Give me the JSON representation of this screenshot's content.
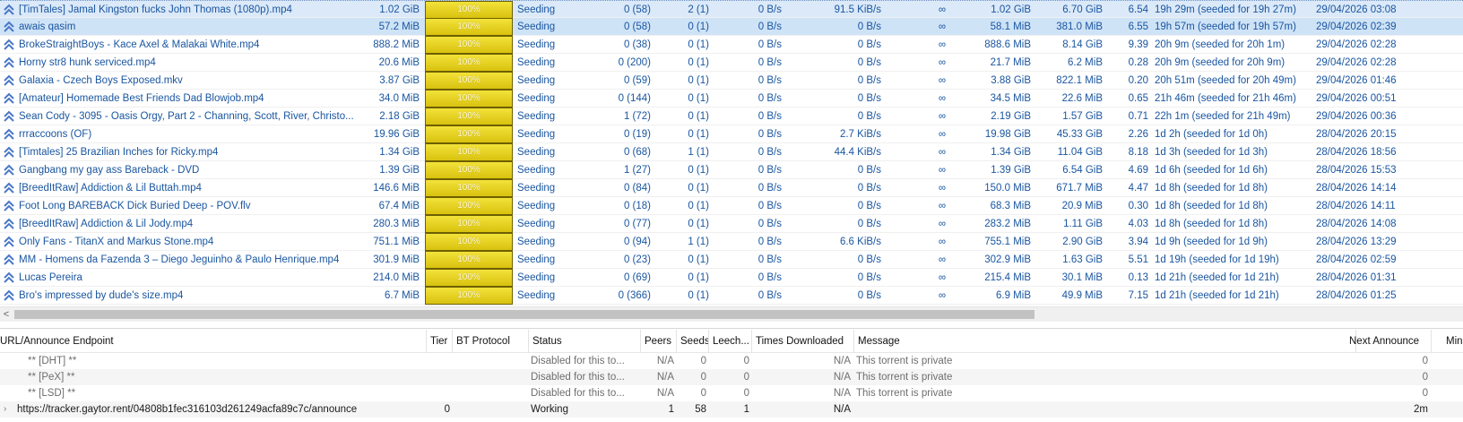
{
  "colors": {
    "selected_row": "#cfe3f7",
    "progress_fill": "#e6d21c",
    "text_blue": "#1a56a0",
    "priority_arrow": "#4a78c8"
  },
  "icons": {
    "row_state": "double-chevron-up-icon",
    "expand": "chevron-right-icon",
    "scroll_left": "arrow-left-icon"
  },
  "torrents": [
    {
      "name": "[TimTales] Jamal Kingston fucks John Thomas (1080p).mp4",
      "size": "1.02 GiB",
      "progress_label": "100%",
      "progress": 1.0,
      "status": "Seeding",
      "seeds": "0 (58)",
      "peers": "2 (1)",
      "down_speed": "0 B/s",
      "up_speed": "91.5 KiB/s",
      "eta": "∞",
      "downloaded": "1.02 GiB",
      "uploaded": "6.70 GiB",
      "ratio": "6.54",
      "seeding_time": "19h 29m (seeded for 19h 27m)",
      "added_on": "29/04/2026 03:08"
    },
    {
      "name": "awais qasim",
      "size": "57.2 MiB",
      "progress_label": "100%",
      "progress": 1.0,
      "status": "Seeding",
      "seeds": "0 (58)",
      "peers": "0 (1)",
      "down_speed": "0 B/s",
      "up_speed": "0 B/s",
      "eta": "∞",
      "downloaded": "58.1 MiB",
      "uploaded": "381.0 MiB",
      "ratio": "6.55",
      "seeding_time": "19h 57m (seeded for 19h 57m)",
      "added_on": "29/04/2026 02:39"
    },
    {
      "name": "BrokeStraightBoys - Kace Axel & Malakai White.mp4",
      "size": "888.2 MiB",
      "progress_label": "100%",
      "progress": 1.0,
      "status": "Seeding",
      "seeds": "0 (38)",
      "peers": "0 (1)",
      "down_speed": "0 B/s",
      "up_speed": "0 B/s",
      "eta": "∞",
      "downloaded": "888.6 MiB",
      "uploaded": "8.14 GiB",
      "ratio": "9.39",
      "seeding_time": "20h 9m (seeded for 20h 1m)",
      "added_on": "29/04/2026 02:28"
    },
    {
      "name": "Horny str8 hunk serviced.mp4",
      "size": "20.6 MiB",
      "progress_label": "100%",
      "progress": 1.0,
      "status": "Seeding",
      "seeds": "0 (200)",
      "peers": "0 (1)",
      "down_speed": "0 B/s",
      "up_speed": "0 B/s",
      "eta": "∞",
      "downloaded": "21.7 MiB",
      "uploaded": "6.2 MiB",
      "ratio": "0.28",
      "seeding_time": "20h 9m (seeded for 20h 9m)",
      "added_on": "29/04/2026 02:28"
    },
    {
      "name": "Galaxia - Czech Boys Exposed.mkv",
      "size": "3.87 GiB",
      "progress_label": "100%",
      "progress": 1.0,
      "status": "Seeding",
      "seeds": "0 (59)",
      "peers": "0 (1)",
      "down_speed": "0 B/s",
      "up_speed": "0 B/s",
      "eta": "∞",
      "downloaded": "3.88 GiB",
      "uploaded": "822.1 MiB",
      "ratio": "0.20",
      "seeding_time": "20h 51m (seeded for 20h 49m)",
      "added_on": "29/04/2026 01:46"
    },
    {
      "name": "[Amateur] Homemade Best Friends Dad Blowjob.mp4",
      "size": "34.0 MiB",
      "progress_label": "100%",
      "progress": 1.0,
      "status": "Seeding",
      "seeds": "0 (144)",
      "peers": "0 (1)",
      "down_speed": "0 B/s",
      "up_speed": "0 B/s",
      "eta": "∞",
      "downloaded": "34.5 MiB",
      "uploaded": "22.6 MiB",
      "ratio": "0.65",
      "seeding_time": "21h 46m (seeded for 21h 46m)",
      "added_on": "29/04/2026 00:51"
    },
    {
      "name": "Sean Cody - 3095 - Oasis Orgy, Part 2 - Channing, Scott, River, Christo...",
      "size": "2.18 GiB",
      "progress_label": "100%",
      "progress": 1.0,
      "status": "Seeding",
      "seeds": "1 (72)",
      "peers": "0 (1)",
      "down_speed": "0 B/s",
      "up_speed": "0 B/s",
      "eta": "∞",
      "downloaded": "2.19 GiB",
      "uploaded": "1.57 GiB",
      "ratio": "0.71",
      "seeding_time": "22h 1m (seeded for 21h 49m)",
      "added_on": "29/04/2026 00:36"
    },
    {
      "name": "rrraccoons (OF)",
      "size": "19.96 GiB",
      "progress_label": "100%",
      "progress": 1.0,
      "status": "Seeding",
      "seeds": "0 (19)",
      "peers": "0 (1)",
      "down_speed": "0 B/s",
      "up_speed": "2.7 KiB/s",
      "eta": "∞",
      "downloaded": "19.98 GiB",
      "uploaded": "45.33 GiB",
      "ratio": "2.26",
      "seeding_time": "1d 2h (seeded for 1d 0h)",
      "added_on": "28/04/2026 20:15"
    },
    {
      "name": "[Timtales] 25 Brazilian Inches for Ricky.mp4",
      "size": "1.34 GiB",
      "progress_label": "100%",
      "progress": 1.0,
      "status": "Seeding",
      "seeds": "0 (68)",
      "peers": "1 (1)",
      "down_speed": "0 B/s",
      "up_speed": "44.4 KiB/s",
      "eta": "∞",
      "downloaded": "1.34 GiB",
      "uploaded": "11.04 GiB",
      "ratio": "8.18",
      "seeding_time": "1d 3h (seeded for 1d 3h)",
      "added_on": "28/04/2026 18:56"
    },
    {
      "name": "Gangbang my gay ass Bareback - DVD",
      "size": "1.39 GiB",
      "progress_label": "100%",
      "progress": 1.0,
      "status": "Seeding",
      "seeds": "1 (27)",
      "peers": "0 (1)",
      "down_speed": "0 B/s",
      "up_speed": "0 B/s",
      "eta": "∞",
      "downloaded": "1.39 GiB",
      "uploaded": "6.54 GiB",
      "ratio": "4.69",
      "seeding_time": "1d 6h (seeded for 1d 6h)",
      "added_on": "28/04/2026 15:53"
    },
    {
      "name": "[BreedItRaw] Addiction & Lil Buttah.mp4",
      "size": "146.6 MiB",
      "progress_label": "100%",
      "progress": 1.0,
      "status": "Seeding",
      "seeds": "0 (84)",
      "peers": "0 (1)",
      "down_speed": "0 B/s",
      "up_speed": "0 B/s",
      "eta": "∞",
      "downloaded": "150.0 MiB",
      "uploaded": "671.7 MiB",
      "ratio": "4.47",
      "seeding_time": "1d 8h (seeded for 1d 8h)",
      "added_on": "28/04/2026 14:14"
    },
    {
      "name": "Foot Long BAREBACK Dick Buried Deep - POV.flv",
      "size": "67.4 MiB",
      "progress_label": "100%",
      "progress": 1.0,
      "status": "Seeding",
      "seeds": "0 (18)",
      "peers": "0 (1)",
      "down_speed": "0 B/s",
      "up_speed": "0 B/s",
      "eta": "∞",
      "downloaded": "68.3 MiB",
      "uploaded": "20.9 MiB",
      "ratio": "0.30",
      "seeding_time": "1d 8h (seeded for 1d 8h)",
      "added_on": "28/04/2026 14:11"
    },
    {
      "name": "[BreedItRaw] Addiction & Lil Jody.mp4",
      "size": "280.3 MiB",
      "progress_label": "100%",
      "progress": 1.0,
      "status": "Seeding",
      "seeds": "0 (77)",
      "peers": "0 (1)",
      "down_speed": "0 B/s",
      "up_speed": "0 B/s",
      "eta": "∞",
      "downloaded": "283.2 MiB",
      "uploaded": "1.11 GiB",
      "ratio": "4.03",
      "seeding_time": "1d 8h (seeded for 1d 8h)",
      "added_on": "28/04/2026 14:08"
    },
    {
      "name": "Only Fans - TitanX and Markus Stone.mp4",
      "size": "751.1 MiB",
      "progress_label": "100%",
      "progress": 1.0,
      "status": "Seeding",
      "seeds": "0 (94)",
      "peers": "1 (1)",
      "down_speed": "0 B/s",
      "up_speed": "6.6 KiB/s",
      "eta": "∞",
      "downloaded": "755.1 MiB",
      "uploaded": "2.90 GiB",
      "ratio": "3.94",
      "seeding_time": "1d 9h (seeded for 1d 9h)",
      "added_on": "28/04/2026 13:29"
    },
    {
      "name": "MM - Homens da Fazenda 3 – Diego Jeguinho & Paulo Henrique.mp4",
      "size": "301.9 MiB",
      "progress_label": "100%",
      "progress": 1.0,
      "status": "Seeding",
      "seeds": "0 (23)",
      "peers": "0 (1)",
      "down_speed": "0 B/s",
      "up_speed": "0 B/s",
      "eta": "∞",
      "downloaded": "302.9 MiB",
      "uploaded": "1.63 GiB",
      "ratio": "5.51",
      "seeding_time": "1d 19h (seeded for 1d 19h)",
      "added_on": "28/04/2026 02:59"
    },
    {
      "name": "Lucas Pereira",
      "size": "214.0 MiB",
      "progress_label": "100%",
      "progress": 1.0,
      "status": "Seeding",
      "seeds": "0 (69)",
      "peers": "0 (1)",
      "down_speed": "0 B/s",
      "up_speed": "0 B/s",
      "eta": "∞",
      "downloaded": "215.4 MiB",
      "uploaded": "30.1 MiB",
      "ratio": "0.13",
      "seeding_time": "1d 21h (seeded for 1d 21h)",
      "added_on": "28/04/2026 01:31"
    },
    {
      "name": "Bro's impressed by dude's size.mp4",
      "size": "6.7 MiB",
      "progress_label": "100%",
      "progress": 1.0,
      "status": "Seeding",
      "seeds": "0 (366)",
      "peers": "0 (1)",
      "down_speed": "0 B/s",
      "up_speed": "0 B/s",
      "eta": "∞",
      "downloaded": "6.9 MiB",
      "uploaded": "49.9 MiB",
      "ratio": "7.15",
      "seeding_time": "1d 21h (seeded for 1d 21h)",
      "added_on": "28/04/2026 01:25"
    }
  ],
  "scrollbar": {
    "left_arrow": "<"
  },
  "trackers": {
    "headers": {
      "url": "URL/Announce Endpoint",
      "tier": "Tier",
      "protocol": "BT Protocol",
      "status": "Status",
      "peers": "Peers",
      "seeds": "Seeds",
      "leechers": "Leech...",
      "times_downloaded": "Times Downloaded",
      "message": "Message",
      "next_announce": "Next Announce",
      "min": "Min"
    },
    "rows": [
      {
        "expander": "",
        "url": "** [DHT] **",
        "tier": "",
        "protocol": "",
        "status": "Disabled for this to...",
        "peers": "N/A",
        "seeds": "0",
        "leechers": "0",
        "times_downloaded": "N/A",
        "message": "This torrent is private",
        "next_announce": "0"
      },
      {
        "expander": "",
        "url": "** [PeX] **",
        "tier": "",
        "protocol": "",
        "status": "Disabled for this to...",
        "peers": "N/A",
        "seeds": "0",
        "leechers": "0",
        "times_downloaded": "N/A",
        "message": "This torrent is private",
        "next_announce": "0"
      },
      {
        "expander": "",
        "url": "** [LSD] **",
        "tier": "",
        "protocol": "",
        "status": "Disabled for this to...",
        "peers": "N/A",
        "seeds": "0",
        "leechers": "0",
        "times_downloaded": "N/A",
        "message": "This torrent is private",
        "next_announce": "0"
      },
      {
        "expander": "›",
        "url": "https://tracker.gaytor.rent/04808b1fec316103d261249acfa89c7c/announce",
        "tier": "0",
        "protocol": "",
        "status": "Working",
        "peers": "1",
        "seeds": "58",
        "leechers": "1",
        "times_downloaded": "N/A",
        "message": "",
        "next_announce": "2m"
      }
    ]
  }
}
